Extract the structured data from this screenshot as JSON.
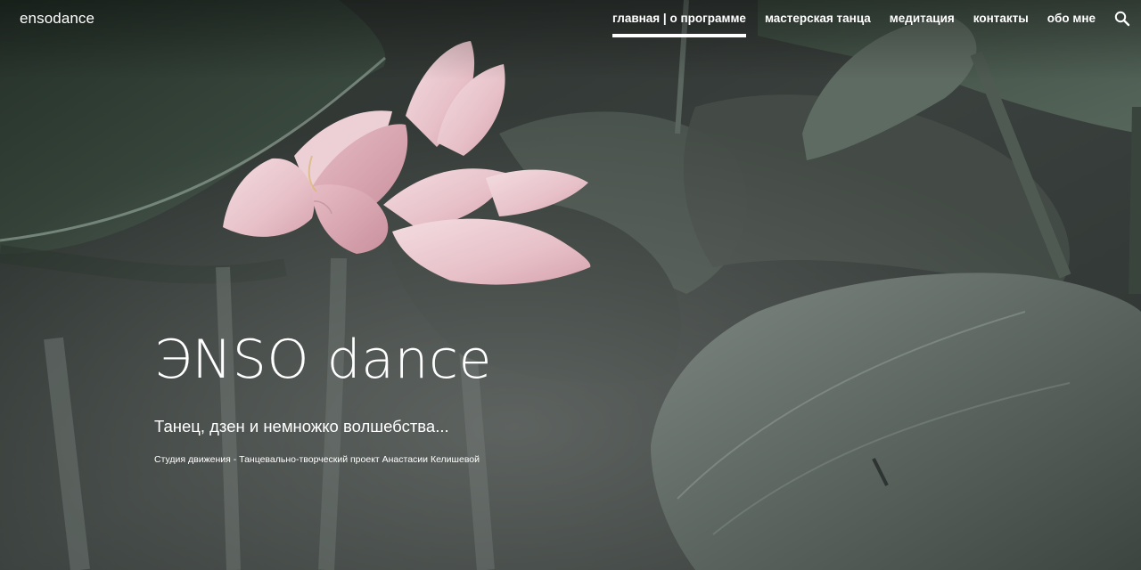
{
  "header": {
    "site_title": "ensodance",
    "nav": [
      {
        "label": "главная | о программе",
        "active": true
      },
      {
        "label": "мастерская танца",
        "active": false
      },
      {
        "label": "медитация",
        "active": false
      },
      {
        "label": "контакты",
        "active": false
      },
      {
        "label": "обо мне",
        "active": false
      }
    ],
    "search_icon": "search-icon"
  },
  "hero": {
    "title": "ЭNSO dance",
    "subtitle": "Танец, дзен и немножко волшебства...",
    "caption": "Студия движения - Танцевально-творческий проект Анастасии Келишевой",
    "background_image": "lotus-flower-with-leaves"
  },
  "colors": {
    "text": "#ffffff",
    "background_dark": "#2c312e",
    "leaf": "#4a5a52",
    "petal": "#e9c4cc"
  }
}
